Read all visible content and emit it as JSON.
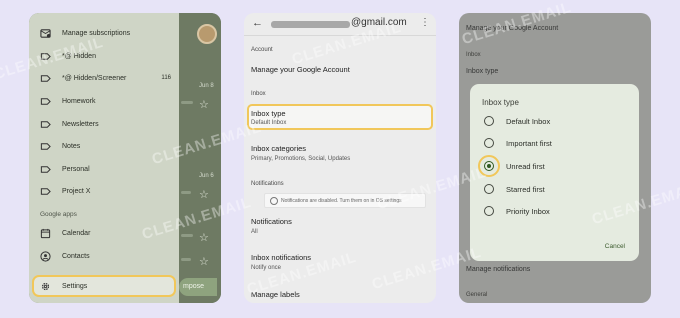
{
  "screens": {
    "drawer": {
      "items": [
        {
          "icon": "manage-subscriptions-icon",
          "label": "Manage subscriptions"
        },
        {
          "icon": "label-icon",
          "label": "*@ Hidden"
        },
        {
          "icon": "label-icon",
          "label": "*@ Hidden/Screener",
          "count": "116"
        },
        {
          "icon": "label-icon",
          "label": "Homework"
        },
        {
          "icon": "label-icon",
          "label": "Newsletters"
        },
        {
          "icon": "label-icon",
          "label": "Notes"
        },
        {
          "icon": "label-icon",
          "label": "Personal"
        },
        {
          "icon": "label-icon",
          "label": "Project X"
        }
      ],
      "section_google_apps": "Google apps",
      "apps": [
        {
          "icon": "calendar-icon",
          "label": "Calendar"
        },
        {
          "icon": "contacts-icon",
          "label": "Contacts"
        }
      ],
      "settings": {
        "icon": "gear-icon",
        "label": "Settings"
      },
      "background": {
        "date1": "Jun 8",
        "date2": "Jun 6",
        "compose": "mpose"
      }
    },
    "settings_list": {
      "email_suffix": "@gmail.com",
      "section_account": "Account",
      "manage_account": "Manage your Google Account",
      "section_inbox": "Inbox",
      "inbox_type_title": "Inbox type",
      "inbox_type_value": "Default Inbox",
      "inbox_categories_title": "Inbox categories",
      "inbox_categories_value": "Primary, Promotions, Social, Updates",
      "section_notifications": "Notifications",
      "notifications_notice": "Notifications are disabled. Turn them on in OS settings",
      "notifications_title": "Notifications",
      "notifications_value": "All",
      "inbox_notifications_title": "Inbox notifications",
      "inbox_notifications_value": "Notify once",
      "manage_labels": "Manage labels"
    },
    "dialog_screen": {
      "bg_manage_account": "Manage your Google Account",
      "bg_inbox": "Inbox",
      "bg_inbox_type": "Inbox type",
      "bg_manage_notifications": "Manage notifications",
      "bg_general": "General",
      "dialog_title": "Inbox type",
      "options": [
        {
          "label": "Default Inbox",
          "selected": false
        },
        {
          "label": "Important first",
          "selected": false
        },
        {
          "label": "Unread first",
          "selected": true
        },
        {
          "label": "Starred first",
          "selected": false
        },
        {
          "label": "Priority Inbox",
          "selected": false
        }
      ],
      "cancel": "Cancel"
    }
  },
  "watermark": "CLEAN.EMAIL",
  "colors": {
    "background": "#e7e4f7",
    "highlight": "#f1c75a",
    "drawer": "#cfd5c6",
    "dialog": "#e5ebe0",
    "selected_radio": "#2f5a22"
  }
}
